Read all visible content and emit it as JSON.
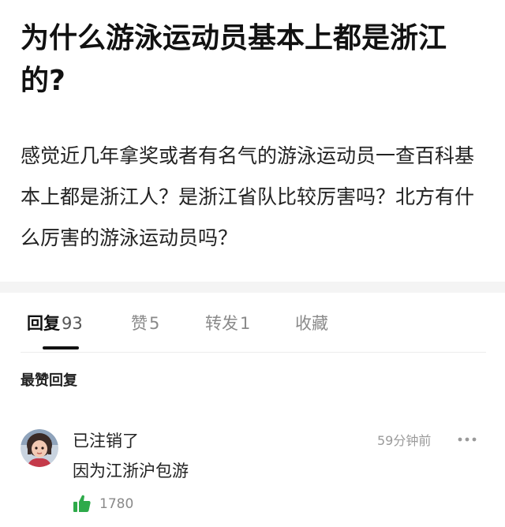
{
  "post": {
    "title": "为什么游泳运动员基本上都是浙江的?",
    "body": "感觉近几年拿奖或者有名气的游泳运动员一查百科基本上都是浙江人？是浙江省队比较厉害吗？北方有什么厉害的游泳运动员吗？"
  },
  "tabs": [
    {
      "label": "回复",
      "count": "93",
      "active": true
    },
    {
      "label": "赞",
      "count": "5",
      "active": false
    },
    {
      "label": "转发",
      "count": "1",
      "active": false
    },
    {
      "label": "收藏",
      "count": "",
      "active": false
    }
  ],
  "section_heading": "最赞回复",
  "comment": {
    "username": "已注销了",
    "timestamp": "59分钟前",
    "text": "因为江浙沪包游",
    "likes": "1780",
    "more_icon": "more-dots-icon",
    "like_icon": "thumbs-up-icon"
  },
  "colors": {
    "primary_text": "#111111",
    "secondary_text": "#8a8a8a",
    "like_green": "#2eaa4a",
    "divider": "#f4f4f4"
  }
}
